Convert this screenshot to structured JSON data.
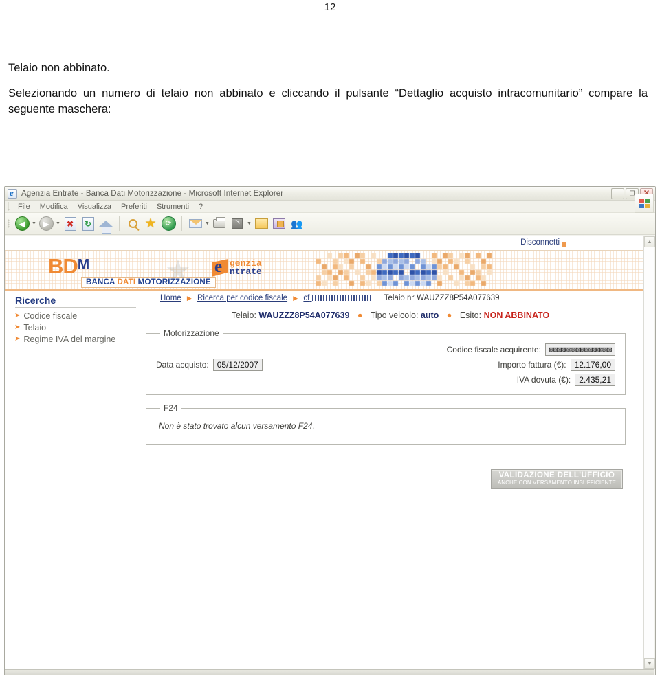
{
  "document": {
    "page_number": "12",
    "paragraph_1": "Telaio non abbinato.",
    "paragraph_2": "Selezionando un numero di telaio non abbinato e cliccando il pulsante “Dettaglio acquisto intracomunitario” compare la seguente maschera:"
  },
  "browser": {
    "title": "Agenzia Entrate - Banca Dati Motorizzazione - Microsoft Internet Explorer",
    "window_buttons": {
      "minimize": "–",
      "restore": "❐",
      "close": "✕"
    },
    "menu": [
      "File",
      "Modifica",
      "Visualizza",
      "Preferiti",
      "Strumenti",
      "?"
    ],
    "toolbar_icons": [
      "back-icon",
      "back-dropdown-icon",
      "forward-icon",
      "forward-dropdown-icon",
      "stop-icon",
      "refresh-icon",
      "home-icon",
      "search-icon",
      "favorites-icon",
      "history-icon",
      "mail-icon",
      "mail-dropdown-icon",
      "print-icon",
      "edit-icon",
      "edit-dropdown-icon",
      "notes-icon",
      "media-icon",
      "messenger-icon"
    ]
  },
  "page": {
    "disconnect_link": "Disconnetti",
    "logo": {
      "bd": "BD",
      "m": "M",
      "strip_banca": "BANCA ",
      "strip_dati": "DATI ",
      "strip_motorizzazione": "MOTORIZZAZIONE",
      "agenzia_line1": "genzia",
      "agenzia_line2": "ntrate"
    },
    "sidebar": {
      "heading": "Ricerche",
      "items": [
        {
          "label": "Codice fiscale"
        },
        {
          "label": "Telaio"
        },
        {
          "label": "Regime IVA del margine"
        }
      ]
    },
    "breadcrumb": {
      "home": "Home",
      "ricerca": "Ricerca per codice fiscale",
      "cf_prefix": "cf",
      "telaio_label": "Telaio n° WAUZZZ8P54A077639"
    },
    "info_line": {
      "telaio_label": "Telaio:",
      "telaio_value": "WAUZZZ8P54A077639",
      "tipo_label": "Tipo veicolo:",
      "tipo_value": "auto",
      "esito_label": "Esito:",
      "esito_value": "NON ABBINATO"
    },
    "motorizzazione": {
      "legend": "Motorizzazione",
      "data_acquisto_label": "Data acquisto:",
      "data_acquisto_value": "05/12/2007",
      "codice_fiscale_label": "Codice fiscale acquirente:",
      "codice_fiscale_value": "▨▨▨▨▨▨▨▨▨▨▨▨▨▨▨▨",
      "importo_label": "Importo fattura (€):",
      "importo_value": "12.176,00",
      "iva_label": "IVA dovuta (€):",
      "iva_value": "2.435,21"
    },
    "f24": {
      "legend": "F24",
      "message": "Non è stato trovato alcun versamento F24."
    },
    "validation_button": {
      "line1": "VALIDAZIONE DELL'UFFICIO",
      "line2": "ANCHE CON VERSAMENTO INSUFFICIENTE"
    }
  },
  "colors": {
    "accent_orange": "#f08a34",
    "brand_blue": "#2b3f8c",
    "error_red": "#c7221a",
    "link_blue": "#2a3d7a"
  }
}
